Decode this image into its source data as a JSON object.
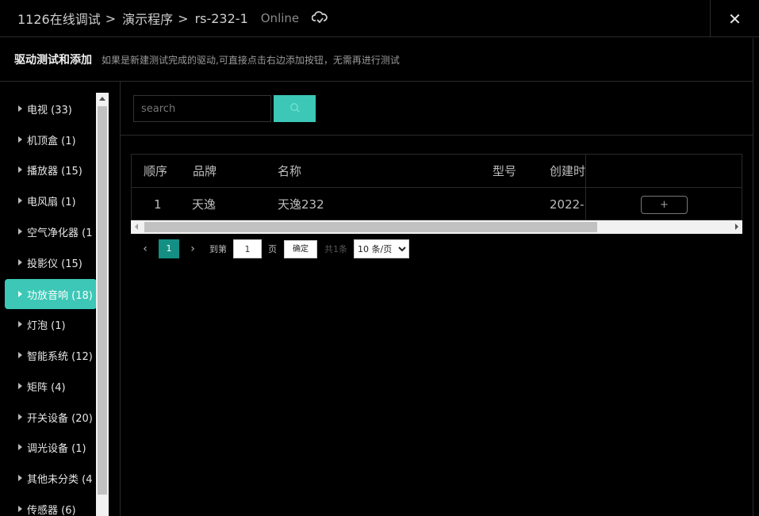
{
  "topbar": {
    "breadcrumbs": [
      "1126在线调试",
      "演示程序",
      "rs-232-1"
    ],
    "status": "Online",
    "close_label": "✕"
  },
  "subbar": {
    "title": "驱动测试和添加",
    "hint": "如果是新建测试完成的驱动,可直接点击右边添加按钮，无需再进行测试"
  },
  "sidebar": {
    "categories": [
      {
        "label": "电视 (33)"
      },
      {
        "label": "机顶盒 (1)"
      },
      {
        "label": "播放器 (15)"
      },
      {
        "label": "电风扇 (1)"
      },
      {
        "label": "空气净化器 (1"
      },
      {
        "label": "投影仪 (15)"
      },
      {
        "label": "功放音响 (18)",
        "active": true
      },
      {
        "label": "灯泡 (1)"
      },
      {
        "label": "智能系统 (12)"
      },
      {
        "label": "矩阵 (4)"
      },
      {
        "label": "开关设备 (20)"
      },
      {
        "label": "调光设备 (1)"
      },
      {
        "label": "其他未分类 (4"
      },
      {
        "label": "传感器 (6)"
      }
    ]
  },
  "search": {
    "placeholder": "search"
  },
  "table": {
    "headers": [
      "顺序",
      "品牌",
      "名称",
      "型号",
      "创建时"
    ],
    "rows": [
      {
        "index": "1",
        "brand": "天逸",
        "name": "天逸232",
        "model": "",
        "created": "2022-",
        "action": "+"
      }
    ]
  },
  "pagination": {
    "current_page": "1",
    "goto_label": "到第",
    "goto_value": "1",
    "page_label": "页",
    "confirm_label": "确定",
    "total_label": "共1条",
    "page_size": "10 条/页"
  },
  "colors": {
    "accent": "#3cc7b6",
    "pager_active": "#148f84",
    "background": "#000000"
  }
}
